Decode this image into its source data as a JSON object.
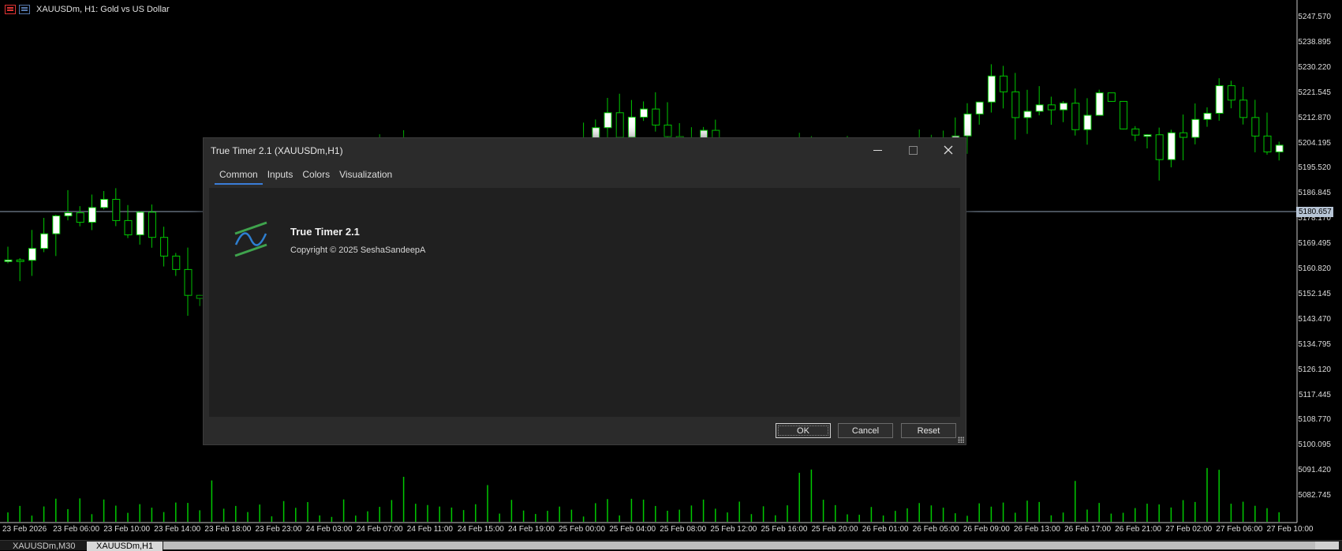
{
  "chart": {
    "symbol_title": "XAUUSDm, H1:  Gold vs US Dollar",
    "current_price": "5180.657",
    "price_labels": [
      "5247.570",
      "5238.895",
      "5230.220",
      "5221.545",
      "5212.870",
      "5204.195",
      "5195.520",
      "5186.845",
      "5178.170",
      "5169.495",
      "5160.820",
      "5152.145",
      "5143.470",
      "5134.795",
      "5126.120",
      "5117.445",
      "5108.770",
      "5100.095",
      "5091.420",
      "5082.745"
    ],
    "time_labels": [
      "23 Feb 2026",
      "23 Feb 06:00",
      "23 Feb 10:00",
      "23 Feb 14:00",
      "23 Feb 18:00",
      "23 Feb 23:00",
      "24 Feb 03:00",
      "24 Feb 07:00",
      "24 Feb 11:00",
      "24 Feb 15:00",
      "24 Feb 19:00",
      "25 Feb 00:00",
      "25 Feb 04:00",
      "25 Feb 08:00",
      "25 Feb 12:00",
      "25 Feb 16:00",
      "25 Feb 20:00",
      "26 Feb 01:00",
      "26 Feb 05:00",
      "26 Feb 09:00",
      "26 Feb 13:00",
      "26 Feb 17:00",
      "26 Feb 21:00",
      "27 Feb 02:00",
      "27 Feb 06:00",
      "27 Feb 10:00"
    ],
    "colors": {
      "bull_body": "#ffffff",
      "bear_body": "#000000",
      "wick": "#00c800",
      "volume": "#00c800",
      "price_line": "#8fa0b4"
    }
  },
  "bottom_tabs": [
    {
      "label": "XAUUSDm,M30",
      "active": false
    },
    {
      "label": "XAUUSDm,H1",
      "active": true
    }
  ],
  "dialog": {
    "title": "True Timer 2.1 (XAUUSDm,H1)",
    "tabs": [
      "Common",
      "Inputs",
      "Colors",
      "Visualization"
    ],
    "active_tab": "Common",
    "indicator_name": "True Timer 2.1",
    "copyright": "Copyright © 2025 SeshaSandeepA",
    "buttons": {
      "ok": "OK",
      "cancel": "Cancel",
      "reset": "Reset"
    },
    "icons": {
      "close": "close-icon",
      "minimize": "minimize-icon",
      "maximize": "maximize-icon",
      "logo": "indicator-logo-icon"
    }
  }
}
